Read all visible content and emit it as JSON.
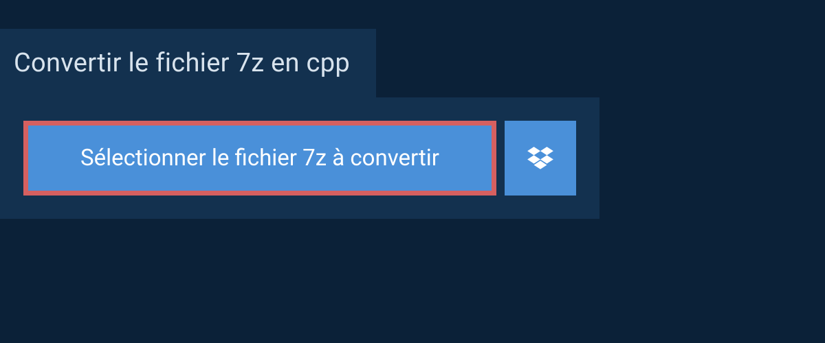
{
  "header": {
    "title": "Convertir le fichier 7z en cpp"
  },
  "actions": {
    "select_file_label": "Sélectionner le fichier 7z à convertir"
  },
  "colors": {
    "background": "#0b2138",
    "panel": "#13314f",
    "button": "#4a90d9",
    "highlight_border": "#d66060",
    "text_light": "#d8e3ed",
    "text_white": "#ffffff"
  }
}
